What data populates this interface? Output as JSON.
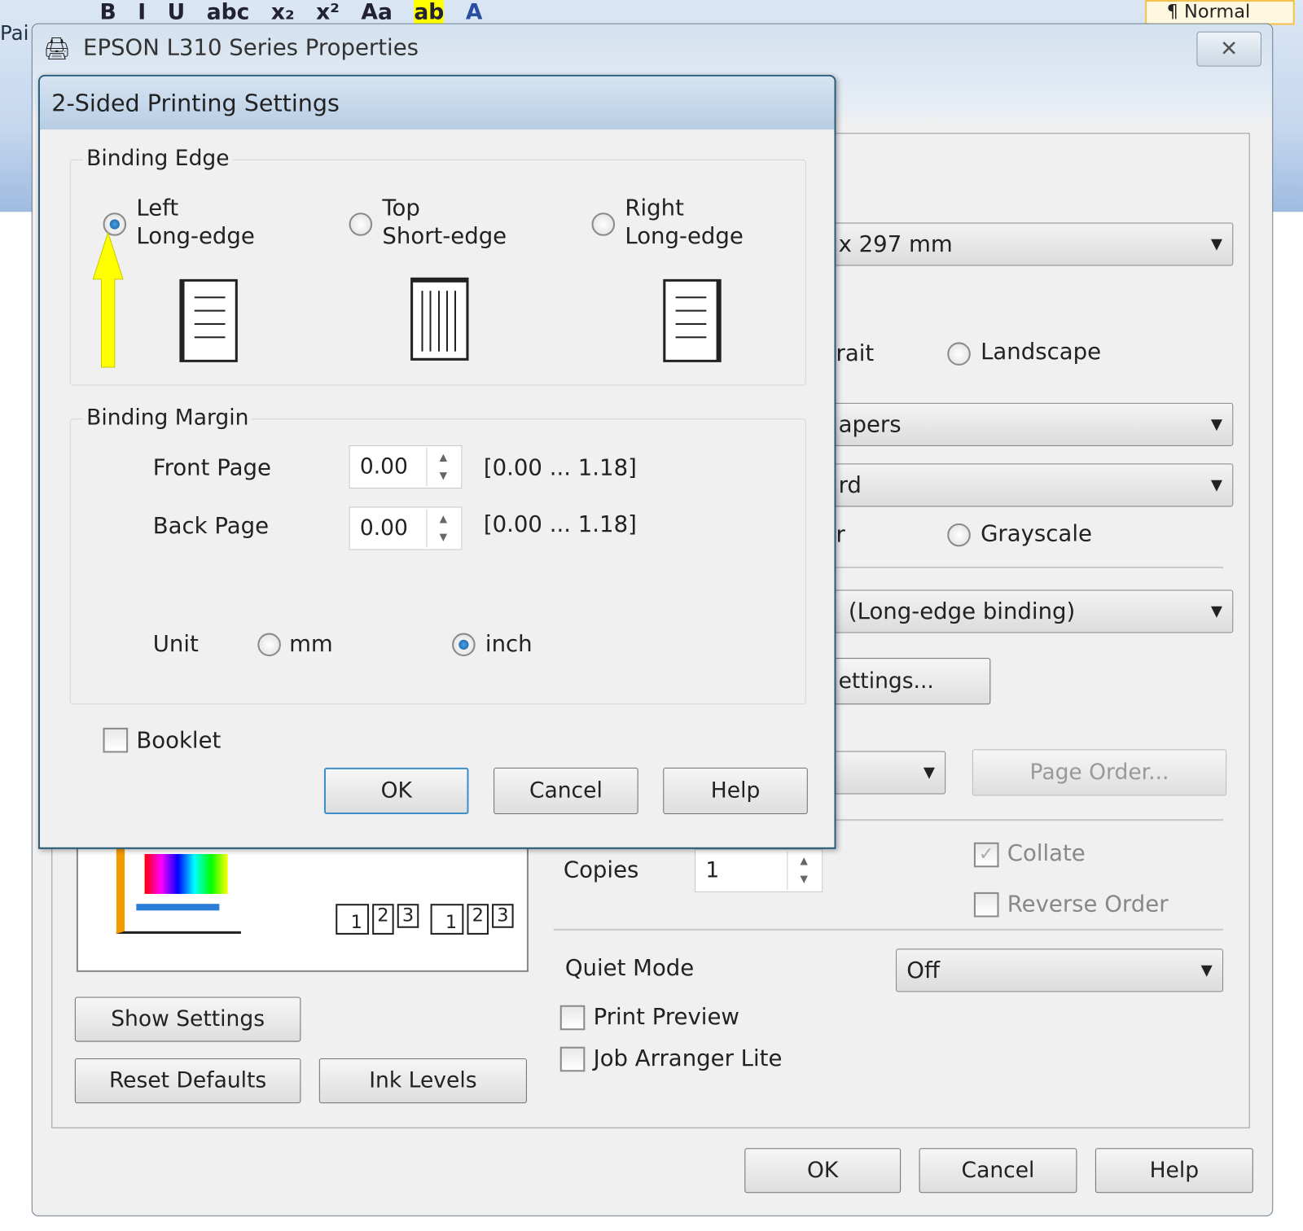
{
  "background_app": {
    "ribbon_tools": [
      "B",
      "I",
      "U",
      "abc",
      "x₂",
      "x²",
      "Aa",
      "ab",
      "A"
    ],
    "style_gallery": "¶ Normal",
    "left_fragment": "Pai"
  },
  "main_window": {
    "title": "EPSON L310 Series Properties",
    "paper_size_fragment": "x 297 mm",
    "orientation": {
      "portrait_fragment": "rait",
      "landscape": "Landscape",
      "selected": "portrait"
    },
    "paper_type_fragment": "apers",
    "quality_fragment": "rd",
    "color": {
      "color_fragment": "r",
      "grayscale": "Grayscale"
    },
    "two_sided_fragment": "(Long-edge binding)",
    "settings_button_fragment": "ettings...",
    "page_order_button": "Page Order...",
    "copies_label": "Copies",
    "copies_value": "1",
    "collate": {
      "label": "Collate",
      "checked": true,
      "enabled": false
    },
    "reverse_order": {
      "label": "Reverse Order",
      "checked": false,
      "enabled": false
    },
    "quiet_mode_label": "Quiet Mode",
    "quiet_mode_value": "Off",
    "print_preview": {
      "label": "Print Preview",
      "checked": false
    },
    "job_arranger": {
      "label": "Job Arranger Lite",
      "checked": false
    },
    "show_settings": "Show Settings",
    "reset_defaults": "Reset Defaults",
    "ink_levels": "Ink Levels",
    "preview_page_numbers": [
      "1",
      "2",
      "3"
    ],
    "ok": "OK",
    "cancel": "Cancel",
    "help": "Help"
  },
  "dialog": {
    "title": "2-Sided Printing Settings",
    "binding_edge": {
      "title": "Binding Edge",
      "selected": "left",
      "options": [
        {
          "line1": "Left",
          "line2": "Long-edge"
        },
        {
          "line1": "Top",
          "line2": "Short-edge"
        },
        {
          "line1": "Right",
          "line2": "Long-edge"
        }
      ]
    },
    "binding_margin": {
      "title": "Binding Margin",
      "front_label": "Front Page",
      "front_value": "0.00",
      "front_range": "[0.00 ... 1.18]",
      "back_label": "Back Page",
      "back_value": "0.00",
      "back_range": "[0.00 ... 1.18]",
      "unit_label": "Unit",
      "unit_mm": "mm",
      "unit_inch": "inch",
      "unit_selected": "inch"
    },
    "booklet": {
      "label": "Booklet",
      "checked": false
    },
    "ok": "OK",
    "cancel": "Cancel",
    "help": "Help"
  },
  "annotation": {
    "arrow_color": "#ffff00"
  }
}
